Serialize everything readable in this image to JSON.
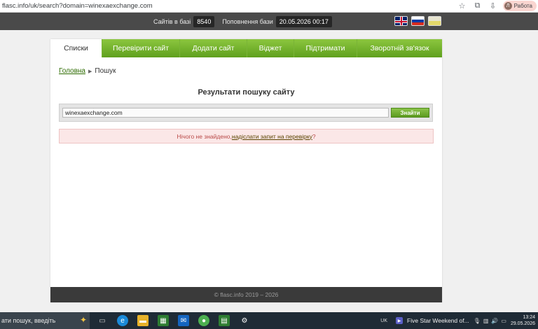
{
  "browser": {
    "url": "flasc.info/uk/search?domain=winexaexchange.com",
    "profile_initial": "Л",
    "profile_label": "Работа"
  },
  "stats": {
    "sites_label": "Сайтів в базі",
    "sites_count": "8540",
    "updated_label": "Поповнення бази",
    "updated_value": "20.05.2026 00:17"
  },
  "nav": {
    "items": [
      {
        "label": "Списки"
      },
      {
        "label": "Перевірити сайт"
      },
      {
        "label": "Додати сайт"
      },
      {
        "label": "Віджет"
      },
      {
        "label": "Підтримати"
      },
      {
        "label": "Зворотній зв'язок"
      }
    ]
  },
  "breadcrumb": {
    "home": "Головна",
    "current": "Пошук"
  },
  "main": {
    "title": "Результати пошуку сайту",
    "search_value": "winexaexchange.com",
    "search_button": "Знайти",
    "alert_text": "Нічого не знайдено, ",
    "alert_link": "надіслати запит на перевірку",
    "alert_end": "?"
  },
  "footer": {
    "text": "© flasc.info 2019 – 2026"
  },
  "taskbar": {
    "search_text": "ати пошук, введіть",
    "lang": "UK",
    "media_title": "Five Star Weekend of...",
    "time": "13:24",
    "date": "29.05.2026"
  }
}
